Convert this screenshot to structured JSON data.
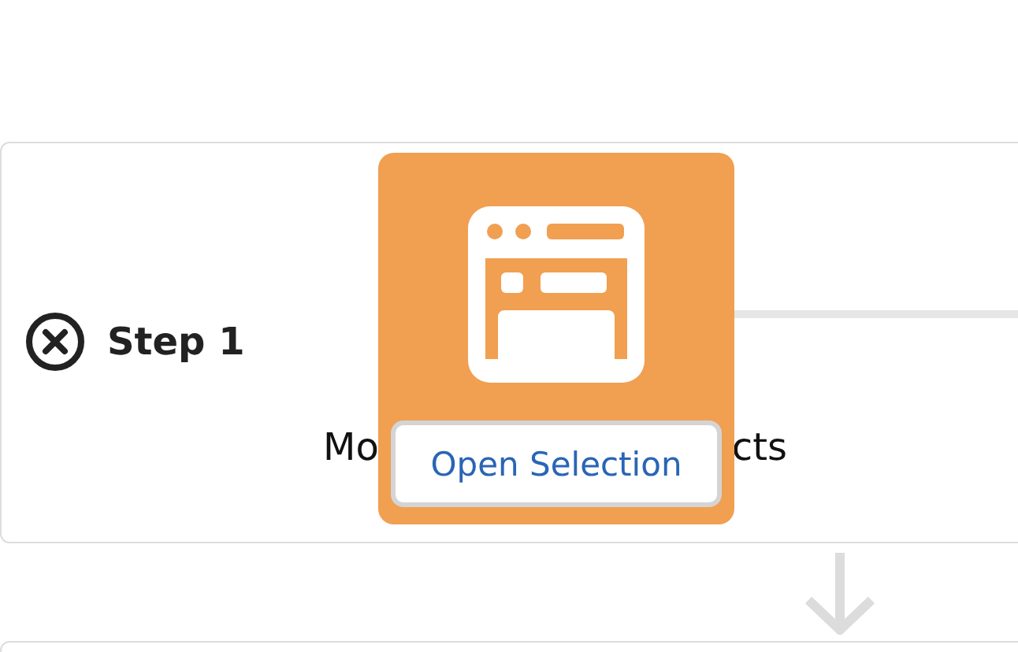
{
  "step": {
    "title": "Step 1",
    "failed": true,
    "description_visible_parts": [
      "Mo",
      "cts"
    ]
  },
  "tile": {
    "button": "Open Selection"
  }
}
